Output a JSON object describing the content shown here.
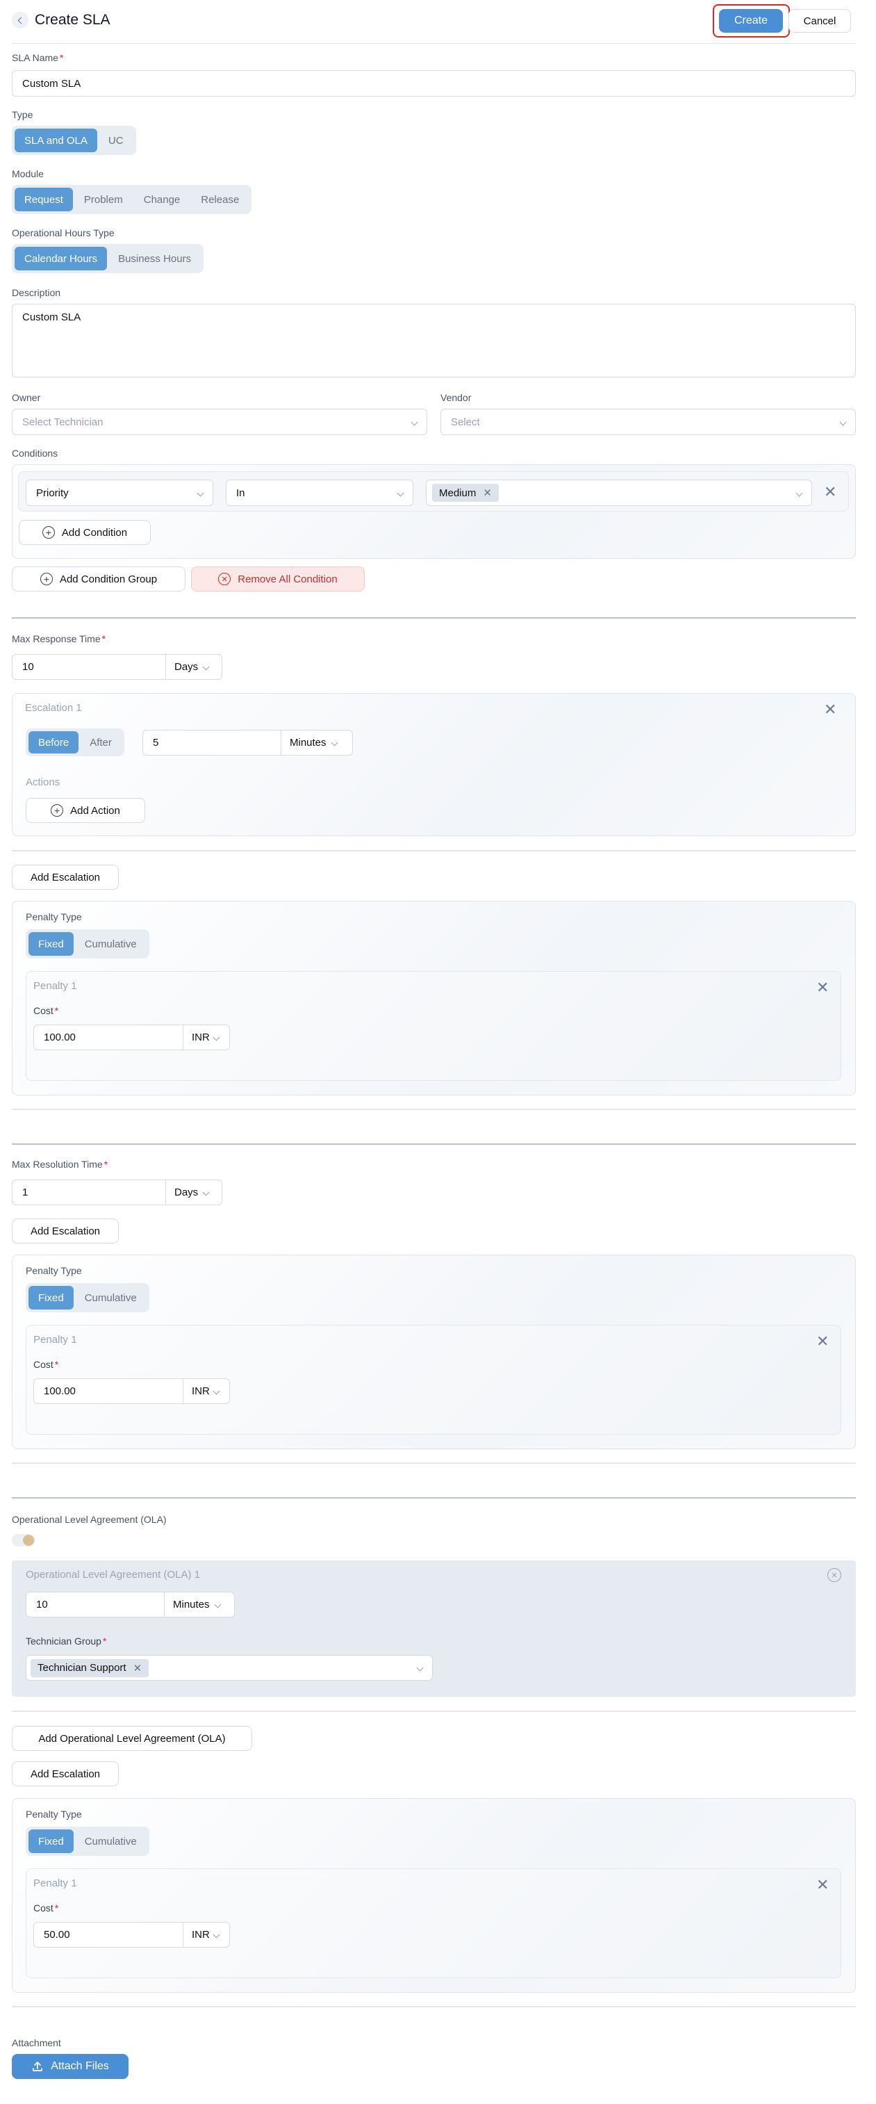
{
  "header": {
    "title": "Create SLA",
    "create_label": "Create",
    "cancel_label": "Cancel"
  },
  "sla_name": {
    "label": "SLA Name",
    "value": "Custom SLA"
  },
  "type": {
    "label": "Type",
    "options": [
      "SLA and OLA",
      "UC"
    ]
  },
  "module": {
    "label": "Module",
    "options": [
      "Request",
      "Problem",
      "Change",
      "Release"
    ]
  },
  "hours_type": {
    "label": "Operational Hours Type",
    "options": [
      "Calendar Hours",
      "Business Hours"
    ]
  },
  "description": {
    "label": "Description",
    "value": "Custom SLA"
  },
  "owner": {
    "label": "Owner",
    "placeholder": "Select Technician"
  },
  "vendor": {
    "label": "Vendor",
    "placeholder": "Select"
  },
  "conditions": {
    "label": "Conditions",
    "field": "Priority",
    "operator": "In",
    "value_tag": "Medium",
    "add_condition": "Add Condition",
    "add_group": "Add Condition Group",
    "remove_all": "Remove All Condition"
  },
  "response": {
    "label": "Max Response Time",
    "value": "10",
    "unit": "Days",
    "escalation": {
      "title": "Escalation 1",
      "options": [
        "Before",
        "After"
      ],
      "value": "5",
      "unit": "Minutes",
      "actions_label": "Actions",
      "add_action": "Add Action"
    },
    "add_escalation": "Add Escalation",
    "penalty": {
      "label": "Penalty Type",
      "options": [
        "Fixed",
        "Cumulative"
      ],
      "title": "Penalty 1",
      "cost_label": "Cost",
      "cost": "100.00",
      "currency": "INR"
    }
  },
  "resolution": {
    "label": "Max Resolution Time",
    "value": "1",
    "unit": "Days",
    "add_escalation": "Add Escalation",
    "penalty": {
      "label": "Penalty Type",
      "options": [
        "Fixed",
        "Cumulative"
      ],
      "title": "Penalty 1",
      "cost_label": "Cost",
      "cost": "100.00",
      "currency": "INR"
    }
  },
  "ola": {
    "label": "Operational Level Agreement (OLA)",
    "block_title": "Operational Level Agreement (OLA) 1",
    "value": "10",
    "unit": "Minutes",
    "group_label": "Technician Group",
    "group_tag": "Technician Support",
    "add_ola": "Add Operational Level Agreement (OLA)",
    "add_escalation": "Add Escalation",
    "penalty": {
      "label": "Penalty Type",
      "options": [
        "Fixed",
        "Cumulative"
      ],
      "title": "Penalty 1",
      "cost_label": "Cost",
      "cost": "50.00",
      "currency": "INR"
    }
  },
  "attachment": {
    "label": "Attachment",
    "button": "Attach Files"
  },
  "colors": {
    "accent": "#4a8fd6",
    "highlight": "#e11d48",
    "danger_bg": "#fde8e8"
  }
}
